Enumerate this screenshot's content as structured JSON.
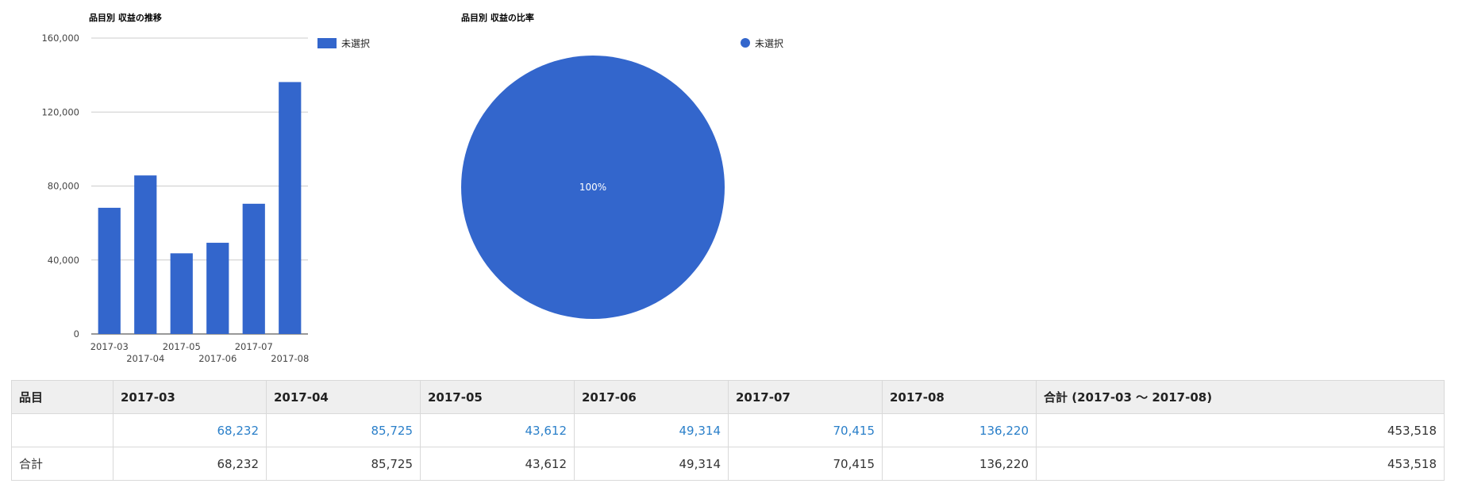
{
  "chart_data": [
    {
      "type": "bar",
      "title": "品目別 収益の推移",
      "categories": [
        "2017-03",
        "2017-04",
        "2017-05",
        "2017-06",
        "2017-07",
        "2017-08"
      ],
      "series": [
        {
          "name": "未選択",
          "values": [
            68232,
            85725,
            43612,
            49314,
            70415,
            136220
          ]
        }
      ],
      "ylim": [
        0,
        160000
      ],
      "yticks": [
        "0",
        "40,000",
        "80,000",
        "120,000",
        "160,000"
      ],
      "xlabel": "",
      "ylabel": "",
      "grid": true,
      "legend": "right",
      "color": "#3366cc"
    },
    {
      "type": "pie",
      "title": "品目別 収益の比率",
      "slices": [
        {
          "name": "未選択",
          "value": 100,
          "label": "100%"
        }
      ],
      "legend": "right",
      "color": "#3366cc"
    }
  ],
  "table": {
    "headers": [
      "品目",
      "2017-03",
      "2017-04",
      "2017-05",
      "2017-06",
      "2017-07",
      "2017-08",
      "合計 (2017-03 〜 2017-08)"
    ],
    "rows": [
      {
        "cells": [
          "",
          "68,232",
          "85,725",
          "43,612",
          "49,314",
          "70,415",
          "136,220",
          "453,518"
        ]
      },
      {
        "cells": [
          "合計",
          "68,232",
          "85,725",
          "43,612",
          "49,314",
          "70,415",
          "136,220",
          "453,518"
        ]
      }
    ]
  }
}
